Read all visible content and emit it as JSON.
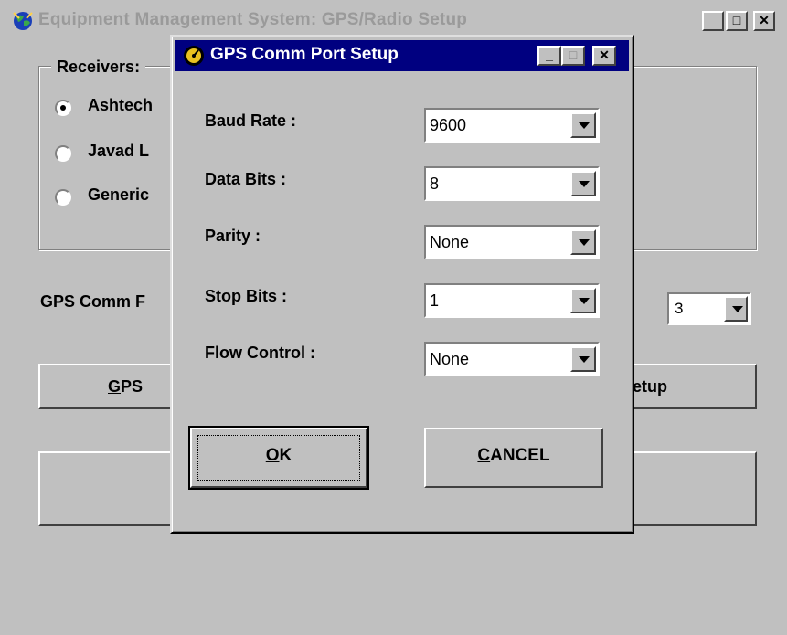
{
  "main_window": {
    "title": "Equipment Management System: GPS/Radio Setup",
    "receivers_label": "Receivers:",
    "receivers": [
      {
        "label": "Ashtech",
        "selected": true
      },
      {
        "label": "Javad L",
        "selected": false
      },
      {
        "label": "Generic",
        "selected": false
      }
    ],
    "gps_comm_label": "GPS Comm F",
    "port_value": "3",
    "gps_setup_button": {
      "underline": "G",
      "rest": "PS"
    },
    "radio_setup_label": "etup"
  },
  "dialog": {
    "title": "GPS Comm Port Setup",
    "fields": [
      {
        "label": "Baud Rate :",
        "value": "9600"
      },
      {
        "label": "Data Bits :",
        "value": "8"
      },
      {
        "label": "Parity :",
        "value": "None"
      },
      {
        "label": "Stop Bits :",
        "value": "1"
      },
      {
        "label": "Flow Control :",
        "value": "None"
      }
    ],
    "ok": {
      "underline": "O",
      "rest": "K"
    },
    "cancel": {
      "underline": "C",
      "rest": "ANCEL"
    }
  },
  "colors": {
    "face": "#c0c0c0",
    "active_title": "#000080",
    "inactive_title_text": "#9a9a9a"
  },
  "icons": [
    "globe-app-icon",
    "gps-dialog-icon",
    "minimize-icon",
    "maximize-icon",
    "close-icon",
    "dropdown-arrow-icon",
    "radio-button-icon"
  ]
}
